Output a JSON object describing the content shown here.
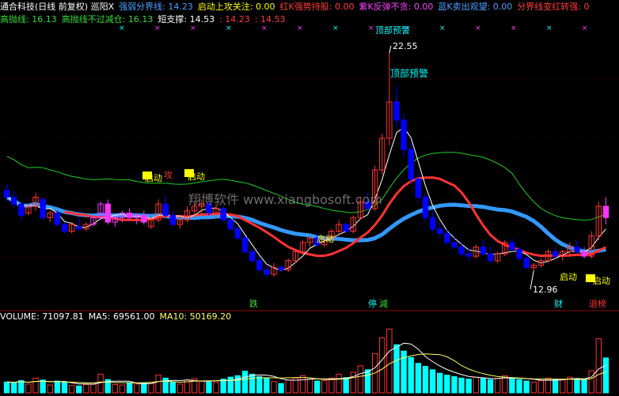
{
  "header_line1": [
    {
      "text": "通合科技(日线 前复权) 巡阳X",
      "color": "#ffffff"
    },
    {
      "text": "强弱分界线: 14.23",
      "color": "#4aa0ff"
    },
    {
      "text": "启动上攻关注: 0.00",
      "color": "#ffff00"
    },
    {
      "text": "红K强势持股: 0.00",
      "color": "#ff3b3b"
    },
    {
      "text": "紫K反弹不贪: 0.00",
      "color": "#ff44ff"
    },
    {
      "text": "蓝K卖出观望: 0.00",
      "color": "#4aa0ff"
    },
    {
      "text": "分界线变红转强: 0",
      "color": "#ff3b3b"
    }
  ],
  "header_line2": [
    {
      "text": "高抛线: 16.13",
      "color": "#33dd33"
    },
    {
      "text": "高抛线不过减仓: 16.13",
      "color": "#33dd33"
    },
    {
      "text": "短支撑: 14.53",
      "color": "#ffffff"
    },
    {
      "text": ": 14.23",
      "color": "#ff3b3b"
    },
    {
      "text": ": 14.53",
      "color": "#ff3b3b"
    }
  ],
  "volume_header": [
    {
      "text": "VOLUME: 71097.81",
      "color": "#ffffff"
    },
    {
      "text": "MA5: 69561.00",
      "color": "#ffffff"
    },
    {
      "text": "MA10: 50169.20",
      "color": "#ffff66"
    }
  ],
  "annotations": {
    "top_warning_top": "顶部预警",
    "top_warning": "顶部预警",
    "peak_price": "22.55",
    "low_price": "12.96",
    "watermark": "翔博软件 www.xiangbosoft.com",
    "start_1": "启动",
    "start_2": "启动",
    "start_3": "启动",
    "start_4": "启动",
    "start_5": "启动",
    "attack": "攻",
    "bottom_die": "跌",
    "bottom_ting": "停",
    "bottom_jian": "減",
    "bottom_cai": "财",
    "bottom_tuibang": "退榜"
  },
  "colors": {
    "up": "#ff3333",
    "down": "#0000ff",
    "purple": "#ff33ff",
    "cyan": "#00ffff",
    "blue_line": "#3399ff",
    "green_line": "#22cc22",
    "white_line": "#ffffff",
    "yellow": "#ffff00",
    "grid": "#8b0000",
    "bg": "#000000"
  },
  "chart_data": {
    "type": "candlestick",
    "price_ylim": [
      12.0,
      23.5
    ],
    "candles": [
      [
        16.5,
        16.8,
        16.0,
        16.2
      ],
      [
        16.2,
        16.5,
        15.7,
        15.9
      ],
      [
        15.9,
        16.0,
        15.2,
        15.4
      ],
      [
        15.5,
        15.9,
        15.4,
        15.8
      ],
      [
        15.8,
        16.4,
        15.6,
        16.2
      ],
      [
        16.1,
        16.2,
        15.2,
        15.3
      ],
      [
        15.3,
        15.6,
        15.1,
        15.5
      ],
      [
        15.5,
        15.6,
        14.9,
        15.0
      ],
      [
        15.0,
        15.1,
        14.6,
        14.7
      ],
      [
        14.7,
        15.1,
        14.6,
        15.0
      ],
      [
        14.9,
        15.3,
        14.7,
        14.8
      ],
      [
        14.8,
        15.1,
        14.7,
        15.0
      ],
      [
        15.0,
        15.4,
        14.9,
        15.3
      ],
      [
        15.3,
        16.0,
        15.2,
        15.9
      ],
      [
        15.9,
        16.1,
        15.0,
        15.1
      ],
      [
        15.1,
        15.4,
        14.9,
        15.3
      ],
      [
        15.3,
        15.6,
        15.1,
        15.5
      ],
      [
        15.5,
        15.7,
        15.2,
        15.3
      ],
      [
        15.3,
        15.5,
        15.0,
        15.4
      ],
      [
        15.4,
        15.6,
        15.0,
        15.1
      ],
      [
        14.9,
        15.4,
        14.8,
        15.2
      ],
      [
        15.2,
        16.1,
        15.1,
        15.9
      ],
      [
        15.9,
        16.3,
        15.3,
        15.4
      ],
      [
        15.4,
        15.6,
        14.9,
        15.0
      ],
      [
        15.0,
        15.3,
        14.8,
        15.2
      ],
      [
        15.2,
        15.8,
        15.1,
        15.6
      ],
      [
        15.6,
        16.0,
        15.4,
        15.8
      ],
      [
        15.8,
        16.1,
        15.5,
        15.9
      ],
      [
        15.9,
        16.0,
        15.4,
        15.5
      ],
      [
        15.5,
        15.9,
        15.3,
        15.7
      ],
      [
        15.7,
        15.8,
        15.1,
        15.2
      ],
      [
        15.2,
        15.3,
        14.7,
        14.8
      ],
      [
        14.8,
        14.9,
        14.3,
        14.4
      ],
      [
        14.4,
        14.5,
        13.7,
        13.8
      ],
      [
        13.8,
        13.9,
        13.3,
        13.4
      ],
      [
        13.4,
        13.6,
        12.9,
        13.0
      ],
      [
        13.0,
        13.2,
        12.7,
        12.8
      ],
      [
        12.8,
        13.3,
        12.7,
        13.1
      ],
      [
        13.1,
        13.2,
        12.9,
        13.0
      ],
      [
        13.0,
        13.5,
        12.9,
        13.4
      ],
      [
        13.4,
        13.9,
        13.3,
        13.8
      ],
      [
        13.8,
        14.3,
        13.7,
        14.2
      ],
      [
        14.2,
        14.5,
        14.0,
        14.4
      ],
      [
        14.4,
        14.6,
        14.0,
        14.1
      ],
      [
        14.1,
        14.5,
        14.0,
        14.4
      ],
      [
        14.4,
        14.8,
        14.3,
        14.7
      ],
      [
        14.7,
        15.2,
        14.5,
        15.0
      ],
      [
        15.0,
        15.1,
        14.6,
        14.7
      ],
      [
        14.7,
        15.4,
        14.6,
        15.3
      ],
      [
        15.3,
        16.2,
        15.2,
        16.0
      ],
      [
        16.0,
        16.4,
        15.5,
        15.7
      ],
      [
        15.7,
        17.6,
        15.6,
        17.4
      ],
      [
        17.4,
        19.0,
        17.2,
        18.8
      ],
      [
        18.8,
        22.55,
        18.5,
        20.4
      ],
      [
        20.4,
        21.1,
        19.3,
        19.6
      ],
      [
        19.6,
        19.9,
        18.0,
        18.3
      ],
      [
        18.3,
        18.6,
        16.8,
        17.0
      ],
      [
        17.0,
        17.3,
        16.0,
        16.2
      ],
      [
        16.2,
        16.4,
        15.1,
        15.3
      ],
      [
        15.3,
        15.6,
        14.7,
        14.8
      ],
      [
        14.8,
        15.1,
        14.4,
        14.6
      ],
      [
        14.6,
        14.8,
        14.1,
        14.2
      ],
      [
        14.2,
        14.5,
        13.9,
        14.0
      ],
      [
        14.0,
        14.2,
        13.6,
        13.7
      ],
      [
        13.7,
        14.0,
        13.4,
        13.6
      ],
      [
        13.6,
        14.1,
        13.5,
        14.0
      ],
      [
        14.0,
        14.3,
        13.6,
        13.7
      ],
      [
        13.7,
        14.0,
        13.3,
        13.4
      ],
      [
        13.4,
        13.8,
        13.3,
        13.7
      ],
      [
        13.7,
        14.3,
        13.6,
        14.2
      ],
      [
        14.2,
        14.4,
        13.8,
        13.9
      ],
      [
        13.9,
        14.0,
        13.4,
        13.5
      ],
      [
        13.5,
        13.6,
        13.0,
        13.1
      ],
      [
        13.1,
        13.3,
        12.96,
        13.2
      ],
      [
        13.2,
        13.5,
        13.1,
        13.4
      ],
      [
        13.4,
        13.9,
        13.3,
        13.8
      ],
      [
        13.8,
        14.0,
        13.5,
        13.6
      ],
      [
        13.6,
        13.9,
        13.4,
        13.8
      ],
      [
        13.8,
        14.2,
        13.6,
        14.0
      ],
      [
        14.0,
        14.3,
        13.7,
        13.8
      ],
      [
        13.8,
        14.0,
        13.5,
        13.6
      ],
      [
        13.6,
        14.7,
        13.5,
        14.5
      ],
      [
        14.5,
        16.0,
        14.3,
        15.8
      ],
      [
        15.8,
        16.2,
        15.0,
        15.3
      ]
    ],
    "volume_ylim": [
      0,
      140000
    ],
    "volume": [
      22000,
      21000,
      25000,
      18000,
      30000,
      26000,
      16000,
      24000,
      21000,
      15000,
      14000,
      17000,
      20000,
      38000,
      27000,
      17000,
      16000,
      21000,
      18000,
      20000,
      19000,
      36000,
      30000,
      22000,
      18000,
      26000,
      29000,
      24000,
      22000,
      21000,
      28000,
      32000,
      35000,
      44000,
      38000,
      33000,
      30000,
      23000,
      19000,
      26000,
      30000,
      35000,
      28000,
      24000,
      25000,
      30000,
      38000,
      31000,
      42000,
      55000,
      47000,
      80000,
      112000,
      130000,
      98000,
      85000,
      72000,
      60000,
      54000,
      47000,
      40000,
      36000,
      33000,
      30000,
      28000,
      32000,
      30000,
      27000,
      29000,
      35000,
      30000,
      27000,
      24000,
      22000,
      25000,
      30000,
      28000,
      27000,
      32000,
      29000,
      27000,
      45000,
      110000,
      71097.81
    ]
  }
}
